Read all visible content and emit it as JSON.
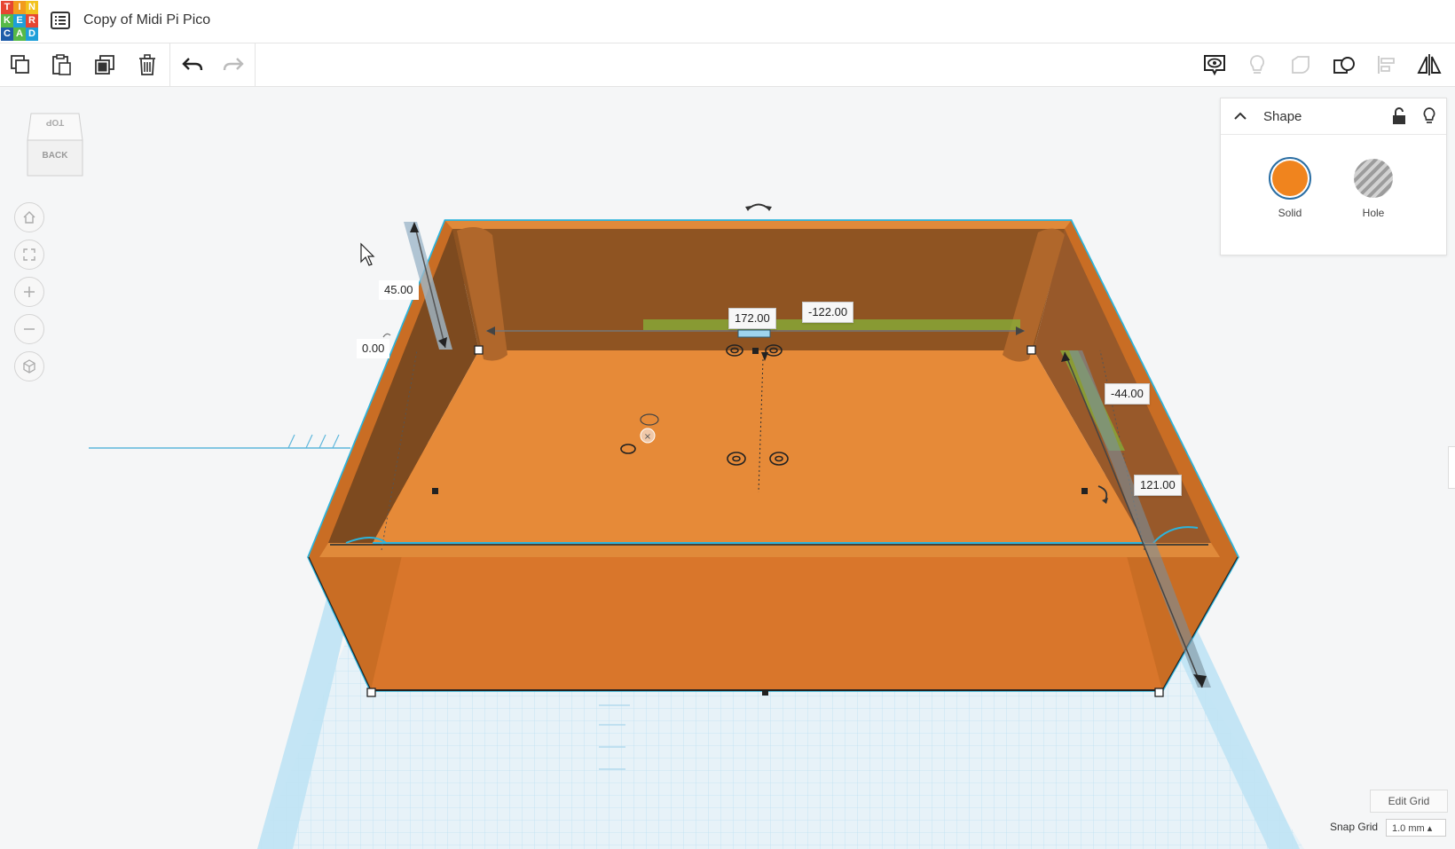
{
  "app": {
    "logo_letters": [
      "T",
      "I",
      "N",
      "K",
      "E",
      "R",
      "C",
      "A",
      "D"
    ],
    "project_title": "Copy of Midi Pi Pico"
  },
  "toolbar": {
    "left_tools": [
      "copy-icon",
      "paste-icon",
      "duplicate-icon",
      "trash-icon",
      "undo-icon",
      "redo-icon"
    ],
    "right_tools": [
      "note-icon",
      "light-bulb-icon",
      "group-icon",
      "ungroup-icon",
      "align-icon",
      "mirror-icon"
    ]
  },
  "view_cube": {
    "top_label": "TOP",
    "front_label": "BACK"
  },
  "nav_controls": [
    "home-view-icon",
    "fit-view-icon",
    "zoom-in-icon",
    "zoom-out-icon",
    "perspective-icon"
  ],
  "dimensions": {
    "height": "45.00",
    "elevation": "0.00",
    "length": "172.00",
    "x_offset": "-122.00",
    "y_offset": "-44.00",
    "width": "121.00"
  },
  "shape_panel": {
    "title": "Shape",
    "solid_label": "Solid",
    "hole_label": "Hole",
    "solid_color": "#f0841e",
    "hole_color": "#b8b8b8"
  },
  "grid": {
    "edit_grid_label": "Edit Grid",
    "snap_grid_label": "Snap Grid",
    "snap_value": "1.0 mm ▴"
  }
}
